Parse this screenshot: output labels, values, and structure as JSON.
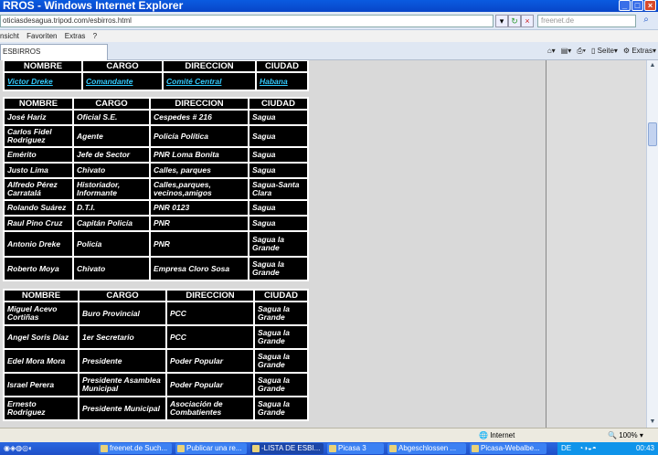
{
  "window": {
    "title": "RROS - Windows Internet Explorer"
  },
  "address": {
    "url": "oticiasdesagua.tripod.com/esbirros.html",
    "search_placeholder": "freenet.de"
  },
  "menu": [
    "nsicht",
    "Favoriten",
    "Extras",
    "?"
  ],
  "tab": {
    "label": "ESBIRROS"
  },
  "toolbar": {
    "page_label": "Seite",
    "extras_label": "Extras"
  },
  "tables": [
    {
      "headers": [
        "NOMBRE",
        "CARGO",
        "DIRECCION",
        "CIUDAD"
      ],
      "rows": [
        [
          "Victor Dreke",
          "Comandante",
          "Comité Central",
          "Habana"
        ]
      ]
    },
    {
      "headers": [
        "NOMBRE",
        "CARGO",
        "DIRECCION",
        "CIUDAD"
      ],
      "rows": [
        [
          "José Hariz",
          "Oficial S.E.",
          "Cespedes # 216",
          "Sagua"
        ],
        [
          "Carlos Fidel Rodriguez",
          "Agente",
          "Policía Política",
          "Sagua"
        ],
        [
          "Emérito",
          "Jefe de Sector",
          "PNR Loma Bonita",
          "Sagua"
        ],
        [
          "Justo Lima",
          "Chivato",
          "Calles, parques",
          "Sagua"
        ],
        [
          "Alfredo Pérez Carratalá",
          "Historiador, Informante",
          "Calles,parques, vecinos,amigos",
          "Sagua-Santa Clara"
        ],
        [
          "Rolando Suárez",
          "D.T.I.",
          "PNR 0123",
          "Sagua"
        ],
        [
          "Raul Pino Cruz",
          "Capitán Policía",
          "PNR",
          "Sagua"
        ],
        [
          "Antonio Dreke",
          "Policía",
          "PNR",
          "Sagua la Grande"
        ],
        [
          "Roberto Moya",
          "Chivato",
          "Empresa Cloro Sosa",
          "Sagua la Grande"
        ]
      ]
    },
    {
      "headers": [
        "NOMBRE",
        "CARGO",
        "DIRECCION",
        "CIUDAD"
      ],
      "rows": [
        [
          "Miguel Acevo Cortiñas",
          "Buro Provincial",
          "PCC",
          "Sagua la Grande"
        ],
        [
          "Angel Soris Díaz",
          "1er Secretario",
          "PCC",
          "Sagua la Grande"
        ],
        [
          "Edel Mora Mora",
          "Presidente",
          "Poder Popular",
          "Sagua la Grande"
        ],
        [
          "Israel Perera",
          "Presidente Asamblea Municipal",
          "Poder Popular",
          "Sagua la Grande"
        ],
        [
          "Ernesto Rodriguez",
          "Presidente Municipal",
          "Asociación de Combatientes",
          "Sagua la Grande"
        ]
      ]
    }
  ],
  "status": {
    "zone": "Internet",
    "zoom": "100%"
  },
  "taskbar": {
    "items": [
      "freenet.de Such...",
      "Publicar una re...",
      "-LISTA DE ESBI...",
      "Picasa 3",
      "Abgeschlossen ...",
      "Picasa-Webalbe..."
    ],
    "lang": "DE",
    "clock": "00:43"
  }
}
